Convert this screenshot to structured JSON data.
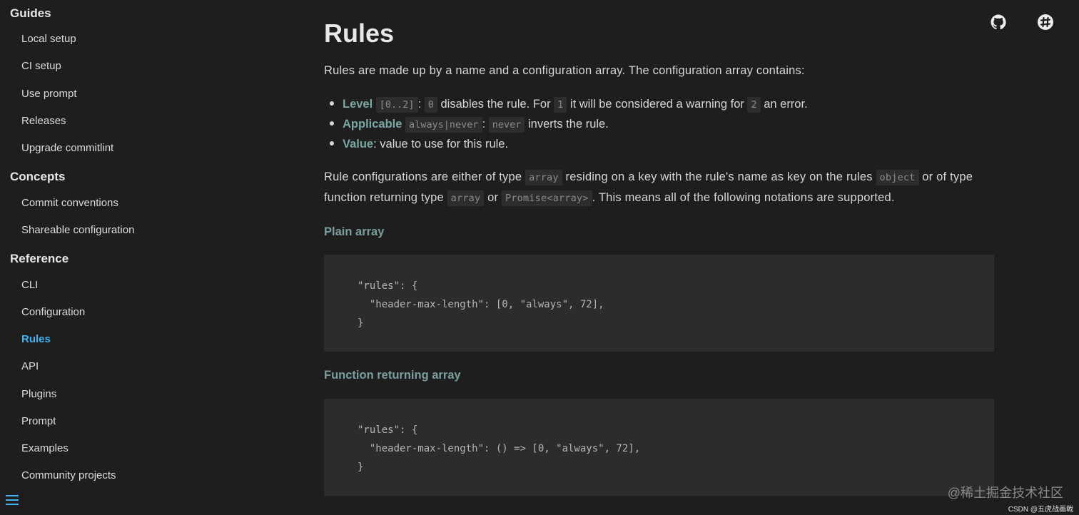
{
  "sidebar": {
    "groups": [
      {
        "title": "Guides",
        "items": [
          "Local setup",
          "CI setup",
          "Use prompt",
          "Releases",
          "Upgrade commitlint"
        ]
      },
      {
        "title": "Concepts",
        "items": [
          "Commit conventions",
          "Shareable configuration"
        ]
      },
      {
        "title": "Reference",
        "items": [
          "CLI",
          "Configuration",
          "Rules",
          "API",
          "Plugins",
          "Prompt",
          "Examples",
          "Community projects"
        ]
      }
    ],
    "active_item": "Rules"
  },
  "header_icons": [
    "github-icon",
    "slack-icon"
  ],
  "main": {
    "title": "Rules",
    "intro": "Rules are made up by a name and a configuration array. The configuration array contains:",
    "bullets": {
      "level": {
        "label": "Level",
        "code1": "[0..2]",
        "sep": ":",
        "code2": "0",
        "t1": "disables the rule. For",
        "code3": "1",
        "t2": "it will be considered a warning for",
        "code4": "2",
        "t3": "an error."
      },
      "applicable": {
        "label": "Applicable",
        "code1": "always|never",
        "sep": ":",
        "code2": "never",
        "t1": "inverts the rule."
      },
      "value": {
        "label": "Value",
        "t1": ": value to use for this rule."
      }
    },
    "para2": {
      "t1": "Rule configurations are either of type",
      "c1": "array",
      "t2": "residing on a key with the rule's name as key on the rules",
      "c2": "object",
      "t3": "or of type",
      "t4": "function returning type",
      "c3": "array",
      "t5": "or",
      "c4": "Promise<array>",
      "t6": ". This means all of the following notations are supported."
    },
    "plain_heading": "Plain array",
    "plain_code": "\"rules\": {\n  \"header-max-length\": [0, \"always\", 72],\n}",
    "func_heading": "Function returning array",
    "func_code": "\"rules\": {\n  \"header-max-length\": () => [0, \"always\", 72],\n}"
  },
  "watermark": "@稀土掘金技术社区",
  "credit": "CSDN @五虎战画戟",
  "colors": {
    "active": "#42b3f4",
    "keyword": "#7aa7a4",
    "background": "#1e1e1e"
  }
}
